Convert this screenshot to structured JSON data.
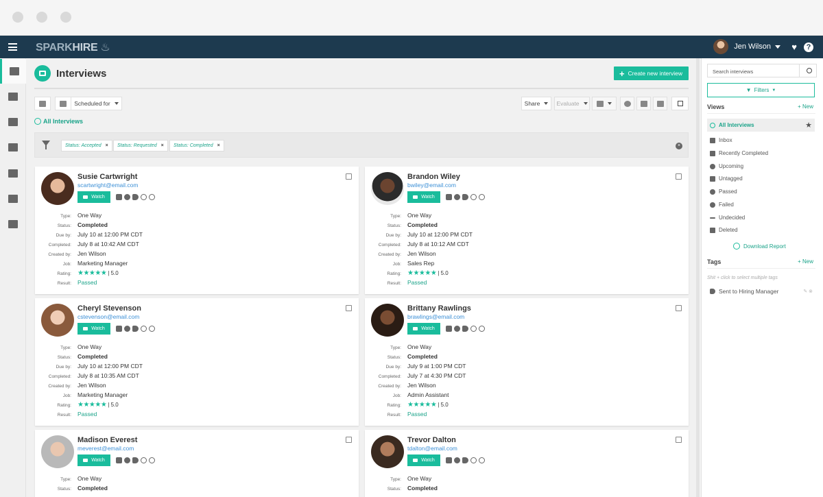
{
  "nav": {
    "logo_main": "SPARK",
    "logo_accent": "HIRE",
    "user_name": "Jen Wilson",
    "help_label": "?"
  },
  "page": {
    "title": "Interviews",
    "create_button": "Create new interview"
  },
  "toolbar": {
    "sort_label": "Scheduled for",
    "share_label": "Share",
    "evaluate_label": "Evaluate"
  },
  "breadcrumb": "All Interviews",
  "filters": [
    {
      "label": "Status: Accepted",
      "remove": "×"
    },
    {
      "label": "Status: Requested",
      "remove": "×"
    },
    {
      "label": "Status: Completed",
      "remove": "×"
    }
  ],
  "field_labels": {
    "type": "Type:",
    "status": "Status:",
    "due": "Due by:",
    "completed": "Completed:",
    "created": "Created by:",
    "job": "Job:",
    "rating": "Rating:",
    "result": "Result:"
  },
  "watch_label": "Watch",
  "stars_glyph": "★★★★★",
  "candidates": [
    {
      "name": "Susie Cartwright",
      "email": "scartwright@email.com",
      "type": "One Way",
      "status": "Completed",
      "due": "July 10 at 12:00 PM CDT",
      "completed": "July 8 at 10:42 AM CDT",
      "created_by": "Jen Wilson",
      "job": "Marketing Manager",
      "rating": "| 5.0",
      "result": "Passed"
    },
    {
      "name": "Brandon Wiley",
      "email": "bwiley@email.com",
      "type": "One Way",
      "status": "Completed",
      "due": "July 10 at 12:00 PM CDT",
      "completed": "July 8 at 10:12 AM CDT",
      "created_by": "Jen Wilson",
      "job": "Sales Rep",
      "rating": "| 5.0",
      "result": "Passed"
    },
    {
      "name": "Cheryl Stevenson",
      "email": "cstevenson@email.com",
      "type": "One Way",
      "status": "Completed",
      "due": "July 10 at 12:00 PM CDT",
      "completed": "July 8 at 10:35 AM CDT",
      "created_by": "Jen Wilson",
      "job": "Marketing Manager",
      "rating": "| 5.0",
      "result": "Passed"
    },
    {
      "name": "Brittany Rawlings",
      "email": "brawlings@email.com",
      "type": "One Way",
      "status": "Completed",
      "due": "July 9 at 1:00 PM CDT",
      "completed": "July 7 at 4:30 PM CDT",
      "created_by": "Jen Wilson",
      "job": "Admin Assistant",
      "rating": "| 5.0",
      "result": "Passed"
    },
    {
      "name": "Madison Everest",
      "email": "meverest@email.com",
      "type": "One Way",
      "status": "Completed"
    },
    {
      "name": "Trevor Dalton",
      "email": "tdalton@email.com",
      "type": "One Way",
      "status": "Completed"
    }
  ],
  "panel": {
    "search_placeholder": "Search interviews",
    "filters_label": "Filters",
    "views_title": "Views",
    "new_label": "+ New",
    "views": [
      "All Interviews",
      "Inbox",
      "Recently Completed",
      "Upcoming",
      "Untagged",
      "Passed",
      "Failed",
      "Undecided",
      "Deleted"
    ],
    "download_label": "Download Report",
    "tags_title": "Tags",
    "tags_hint": "Shit + click to select multiple tags",
    "tags": [
      "Sent to Hiring Manager"
    ]
  },
  "colors": {
    "accent": "#1abc9c",
    "navbar": "#1d3a4f",
    "link": "#3b8fd6"
  }
}
